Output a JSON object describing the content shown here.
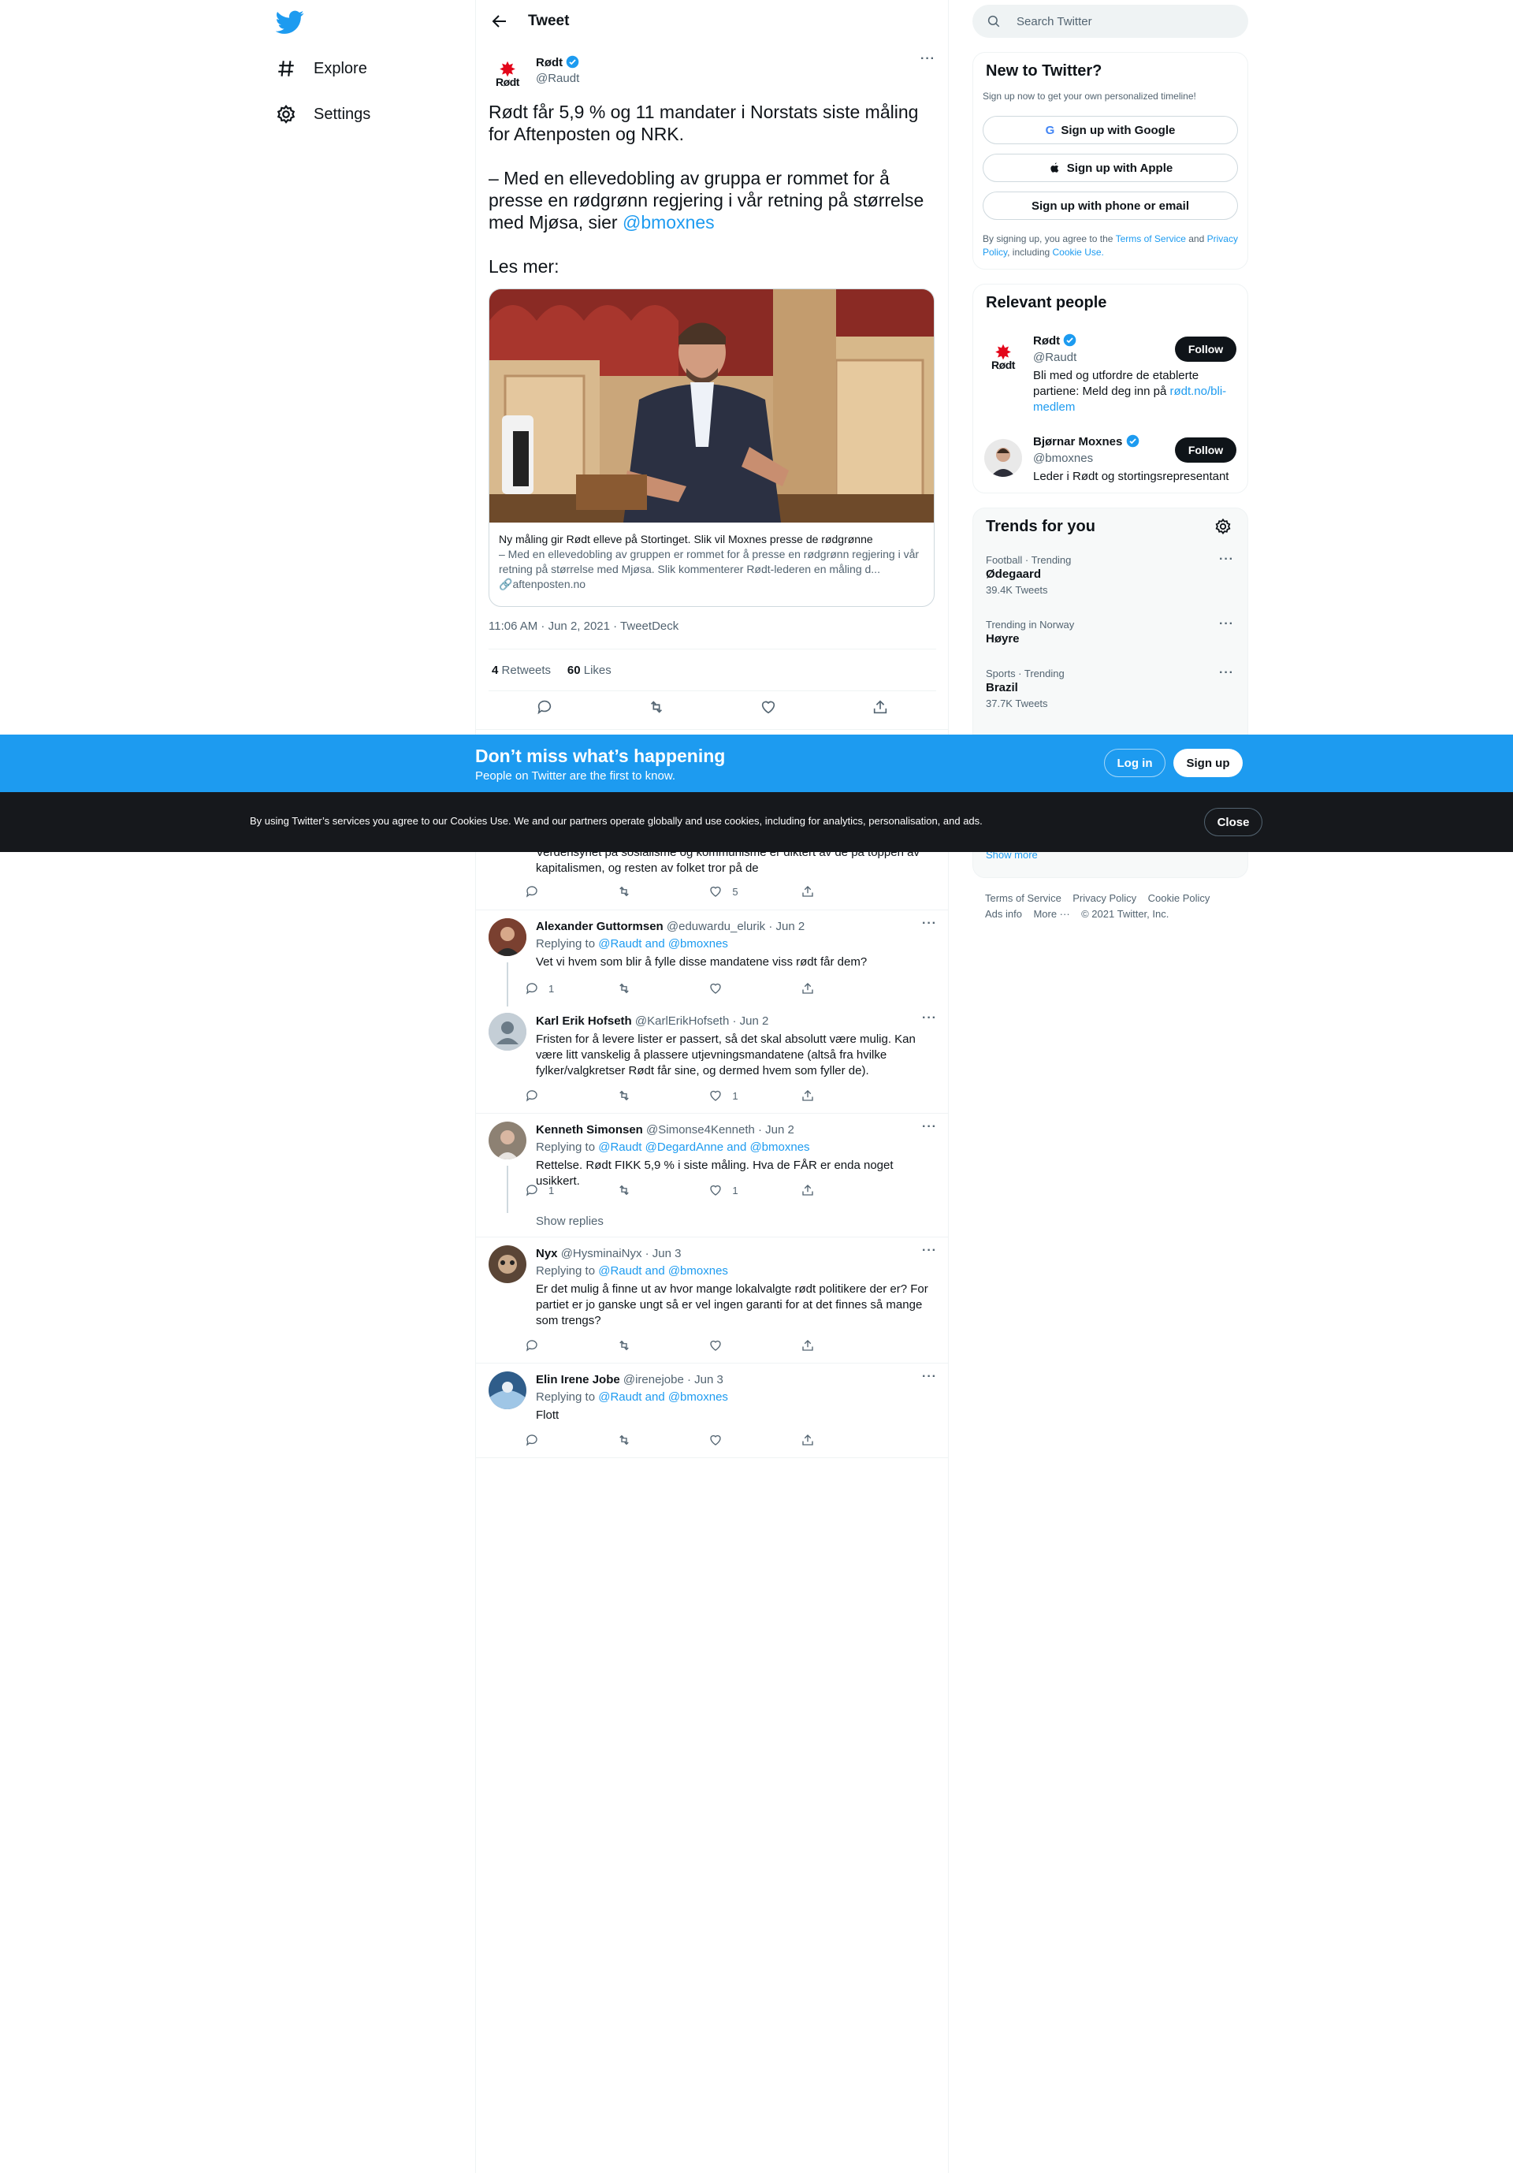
{
  "nav": {
    "explore": "Explore",
    "settings": "Settings"
  },
  "header": {
    "title": "Tweet"
  },
  "main_tweet": {
    "author_name": "Rødt",
    "author_handle": "@Raudt",
    "avatar_text": "Rødt",
    "text_part1": "Rødt får 5,9 % og 11 mandater i Norstats siste måling for Aftenposten og NRK.\n\n– Med en ellevedobling av gruppa er rommet for å presse en rødgrønn regjering i vår retning på størrelse med Mjøsa, sier ",
    "mention": "@bmoxnes",
    "text_part2": "\n\nLes mer:",
    "card": {
      "title": "Ny måling gir Rødt elleve på Stortinget. Slik vil Moxnes presse de rødgrønne",
      "description": "– Med en ellevedobling av gruppen er rommet for å presse en rødgrønn regjering i vår retning på størrelse med Mjøsa. Slik kommenterer Rødt-lederen en måling d...",
      "domain": "aftenposten.no"
    },
    "timestamp": "11:06 AM · Jun 2, 2021 · TweetDeck",
    "retweets_count": "4",
    "retweets_label": "Retweets",
    "likes_count": "60",
    "likes_label": "Likes"
  },
  "partial_reply": {
    "text": "kapitalismen, og resten av folket tror på de",
    "hidden_text": "Verdensynet på sosialisme og kommunisme er diktert av de på toppen av",
    "likes": "5"
  },
  "replies": [
    {
      "name": "Alexander Guttormsen",
      "handle": "@eduwardu_elurik · Jun 2",
      "replying_prefix": "Replying to ",
      "replying_to": "@Raudt and @bmoxnes",
      "text": "Vet vi hvem som blir å fylle disse mandatene viss rødt får dem?",
      "replies": "1",
      "retweets": "",
      "likes": ""
    },
    {
      "name": "Karl Erik Hofseth",
      "handle": "@KarlErikHofseth · Jun 2",
      "text": "Fristen for å levere lister er passert, så det skal absolutt være mulig. Kan være litt vanskelig å plassere utjevningsmandatene (altså fra hvilke fylker/valgkretser Rødt får sine, og dermed hvem som fyller de).",
      "replies": "",
      "retweets": "",
      "likes": "1"
    },
    {
      "name": "Kenneth Simonsen",
      "handle": "@Simonse4Kenneth · Jun 2",
      "replying_prefix": "Replying to ",
      "replying_to": "@Raudt @DegardAnne and @bmoxnes",
      "text": "Rettelse. Rødt FIKK 5,9 % i siste måling. Hva de FÅR er enda noget usikkert.",
      "replies": "1",
      "retweets": "",
      "likes": "1",
      "show_replies": "Show replies"
    },
    {
      "name": "Nyx",
      "handle": "@HysminaiNyx · Jun 3",
      "replying_prefix": "Replying to ",
      "replying_to": "@Raudt and @bmoxnes",
      "text": "Er det mulig å finne ut av hvor mange lokalvalgte rødt politikere der er? For partiet er jo ganske ungt så er vel ingen garanti for at det finnes så mange som trengs?",
      "replies": "",
      "retweets": "",
      "likes": ""
    },
    {
      "name": "Elin Irene Jobe",
      "handle": "@irenejobe · Jun 3",
      "replying_prefix": "Replying to ",
      "replying_to": "@Raudt and @bmoxnes",
      "text": "Flott",
      "replies": "",
      "retweets": "",
      "likes": ""
    }
  ],
  "search": {
    "placeholder": "Search Twitter"
  },
  "new_to_twitter": {
    "title": "New to Twitter?",
    "subtitle": "Sign up now to get your own personalized timeline!",
    "google": "Sign up with Google",
    "apple": "Sign up with Apple",
    "phone": "Sign up with phone or email",
    "terms_prefix": "By signing up, you agree to the ",
    "terms": "Terms of Service",
    "and": " and ",
    "privacy": "Privacy Policy",
    "including": ", including ",
    "cookie": "Cookie Use."
  },
  "relevant_people": {
    "title": "Relevant people",
    "people": [
      {
        "name": "Rødt",
        "handle": "@Raudt",
        "bio_prefix": "Bli med og utfordre de etablerte partiene: Meld deg inn på ",
        "bio_link": "rødt.no/bli-medlem",
        "follow": "Follow"
      },
      {
        "name": "Bjørnar Moxnes",
        "handle": "@bmoxnes",
        "bio": "Leder i Rødt og stortingsrepresentant",
        "follow": "Follow"
      }
    ]
  },
  "trends": {
    "title": "Trends for you",
    "items": [
      {
        "category": "Football · Trending",
        "name": "Ødegaard",
        "count": "39.4K Tweets"
      },
      {
        "category": "Trending in Norway",
        "name": "Høyre",
        "count": ""
      },
      {
        "category": "Sports · Trending",
        "name": "Brazil",
        "count": "37.7K Tweets"
      }
    ],
    "show_more": "Show more"
  },
  "footer": {
    "terms": "Terms of Service",
    "privacy": "Privacy Policy",
    "cookie": "Cookie Policy",
    "ads": "Ads info",
    "more": "More ···",
    "copyright": "© 2021 Twitter, Inc."
  },
  "signup_banner": {
    "heading": "Don’t miss what’s happening",
    "sub": "People on Twitter are the first to know.",
    "login": "Log in",
    "signup": "Sign up"
  },
  "cookie_banner": {
    "text": "By using Twitter’s services you agree to our Cookies Use. We and our partners operate globally and use cookies, including for analytics, personalisation, and ads.",
    "close": "Close"
  },
  "colors": {
    "accent": "#1d9bf0",
    "text": "#0f1419",
    "muted": "#536471",
    "brand_red": "#e3071b"
  }
}
